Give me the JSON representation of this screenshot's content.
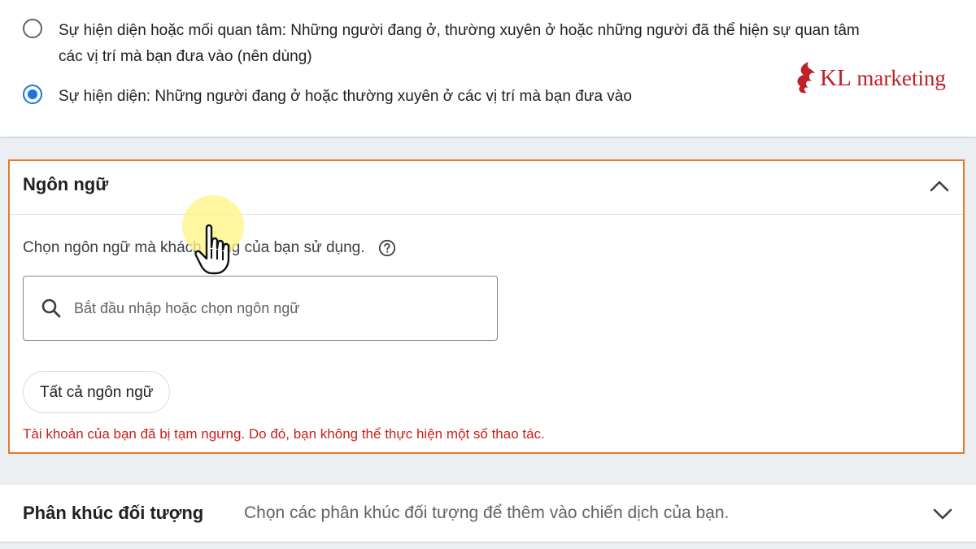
{
  "location_options": {
    "options": [
      {
        "line1": "Sự hiện diện hoặc mối quan tâm: Những người đang ở, thường xuyên ở hoặc những người đã thể hiện sự quan tâm",
        "line2": "các vị trí mà bạn đưa vào (nên dùng)",
        "selected": false
      },
      {
        "line1": "Sự hiện diện: Những người đang ở hoặc thường xuyên ở các vị trí mà bạn đưa vào",
        "selected": true
      }
    ]
  },
  "logo": {
    "text_kl": "KL",
    "text_marketing": " marketing",
    "color": "#c0202a"
  },
  "language_section": {
    "title": "Ngôn ngữ",
    "prompt": "Chọn ngôn ngữ mà khách hàng của bạn sử dụng.",
    "search": {
      "placeholder": "Bắt đầu nhập hoặc chọn ngôn ngữ",
      "value": ""
    },
    "chip_label": "Tất cả ngôn ngữ",
    "warning": "Tài khoản của bạn đã bị tạm ngưng. Do đó, bạn không thể thực hiện một số thao tác.",
    "highlight_border_color": "#e8782c",
    "warning_color": "#c5221f",
    "icons": {
      "collapse": "chevron-up-icon",
      "help": "help-circle-icon",
      "search": "search-icon"
    }
  },
  "audience_segment": {
    "title": "Phân khúc đối tượng",
    "description": "Chọn các phân khúc đối tượng để thêm vào chiến dịch của bạn.",
    "icon": "chevron-down-icon"
  },
  "colors": {
    "accent": "#1a73e8"
  }
}
